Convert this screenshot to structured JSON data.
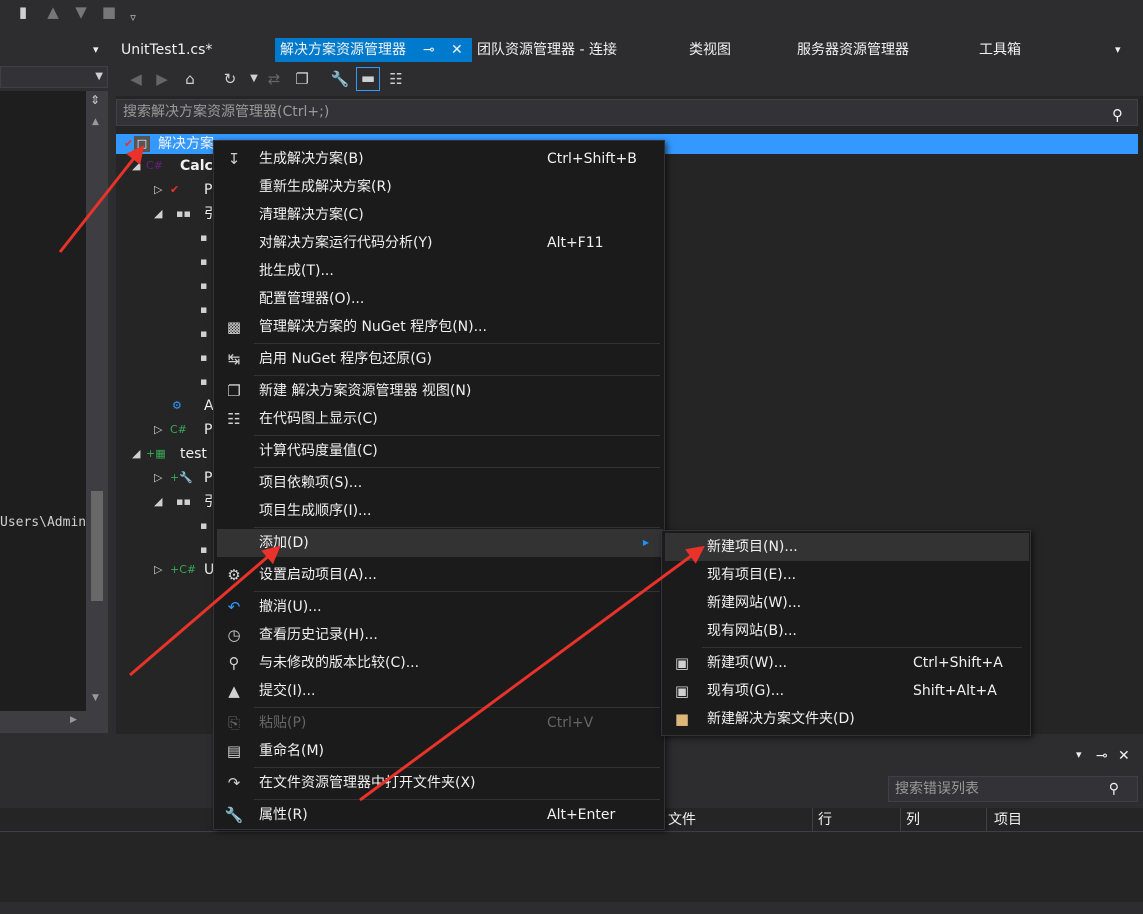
{
  "toolbar_top": {
    "icons": [
      "bookmark-icon",
      "prev-bookmark-icon",
      "next-bookmark-icon",
      "clear-bookmark-icon",
      "overflow-icon"
    ]
  },
  "tabs": {
    "dropdown_glyph": "▾",
    "items": [
      {
        "label": "UnitTest1.cs*"
      },
      {
        "label": "解决方案资源管理器",
        "pin": "⊸",
        "close": "✕"
      },
      {
        "label": "团队资源管理器 - 连接"
      },
      {
        "label": "类视图"
      },
      {
        "label": "服务器资源管理器"
      },
      {
        "label": "工具箱"
      }
    ]
  },
  "left_panel": {
    "path_text": "Users\\Admin"
  },
  "solution_explorer": {
    "search_placeholder": "搜索解决方案资源管理器(Ctrl+;)",
    "search_icon": "⚲",
    "tree": {
      "solution_label": "解决方案",
      "project1": "Calc",
      "node_p1": "P",
      "node_ref1": "引",
      "node_a": "A",
      "node_p2": "P",
      "project2": "test",
      "node_p3": "P",
      "node_ref2": "引",
      "node_u": "U"
    }
  },
  "context_menu": {
    "items": [
      {
        "label": "生成解决方案(B)",
        "shortcut": "Ctrl+Shift+B",
        "icon": "build-icon"
      },
      {
        "label": "重新生成解决方案(R)",
        "shortcut": ""
      },
      {
        "label": "清理解决方案(C)",
        "shortcut": ""
      },
      {
        "label": "对解决方案运行代码分析(Y)",
        "shortcut": "Alt+F11"
      },
      {
        "label": "批生成(T)...",
        "shortcut": ""
      },
      {
        "label": "配置管理器(O)...",
        "shortcut": ""
      },
      {
        "label": "管理解决方案的 NuGet 程序包(N)...",
        "shortcut": "",
        "icon": "nuget-icon"
      },
      {
        "label": "启用 NuGet 程序包还原(G)",
        "shortcut": "",
        "icon": "restore-icon"
      },
      {
        "label": "新建 解决方案资源管理器 视图(N)",
        "shortcut": "",
        "icon": "new-view-icon"
      },
      {
        "label": "在代码图上显示(C)",
        "shortcut": "",
        "icon": "code-map-icon"
      },
      {
        "label": "计算代码度量值(C)",
        "shortcut": ""
      },
      {
        "label": "项目依赖项(S)...",
        "shortcut": ""
      },
      {
        "label": "项目生成顺序(I)...",
        "shortcut": ""
      },
      {
        "label": "添加(D)",
        "shortcut": "",
        "submenu_arrow": "▶"
      },
      {
        "label": "设置启动项目(A)...",
        "shortcut": "",
        "icon": "settings-icon"
      },
      {
        "label": "撤消(U)...",
        "shortcut": "",
        "icon": "undo-icon"
      },
      {
        "label": "查看历史记录(H)...",
        "shortcut": "",
        "icon": "history-icon"
      },
      {
        "label": "与未修改的版本比较(C)...",
        "shortcut": "",
        "icon": "compare-icon"
      },
      {
        "label": "提交(I)...",
        "shortcut": "",
        "icon": "commit-icon"
      },
      {
        "label": "粘贴(P)",
        "shortcut": "Ctrl+V",
        "icon": "paste-icon",
        "disabled": true
      },
      {
        "label": "重命名(M)",
        "shortcut": "",
        "icon": "rename-icon"
      },
      {
        "label": "在文件资源管理器中打开文件夹(X)",
        "shortcut": "",
        "icon": "open-folder-icon"
      },
      {
        "label": "属性(R)",
        "shortcut": "Alt+Enter",
        "icon": "properties-icon"
      }
    ]
  },
  "submenu": {
    "items": [
      {
        "label": "新建项目(N)...",
        "shortcut": ""
      },
      {
        "label": "现有项目(E)...",
        "shortcut": ""
      },
      {
        "label": "新建网站(W)...",
        "shortcut": ""
      },
      {
        "label": "现有网站(B)...",
        "shortcut": ""
      },
      {
        "label": "新建项(W)...",
        "shortcut": "Ctrl+Shift+A",
        "icon": "new-item-icon"
      },
      {
        "label": "现有项(G)...",
        "shortcut": "Shift+Alt+A",
        "icon": "existing-item-icon"
      },
      {
        "label": "新建解决方案文件夹(D)",
        "shortcut": "",
        "icon": "folder-icon"
      }
    ]
  },
  "error_list": {
    "search_placeholder": "搜索错误列表",
    "columns": [
      "文件",
      "行",
      "列",
      "项目"
    ],
    "pin": "⊸",
    "close": "✕",
    "dropdown": "▾"
  },
  "colors": {
    "accent": "#007acc",
    "selection": "#3399ff",
    "arrow": "#e8322a"
  }
}
